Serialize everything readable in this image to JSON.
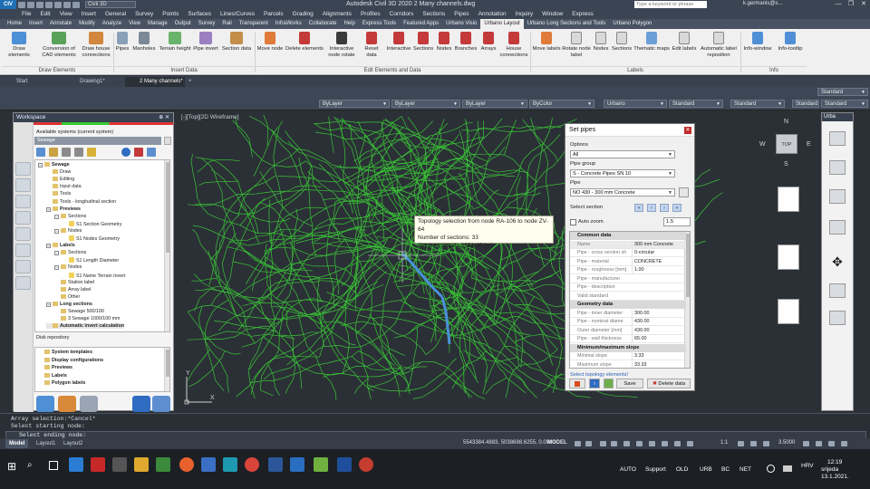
{
  "titlebar": {
    "app_icon_label": "CIV",
    "workspace": "Civil 3D",
    "title": "Autodesk Civil 3D 2020     2 Many channels.dwg",
    "search_placeholder": "Type a keyword or phrase",
    "user": "k.germanis@s...",
    "minimize": "—",
    "restore": "❐",
    "close": "✕"
  },
  "menubar": {
    "items": [
      "File",
      "Edit",
      "View",
      "Insert",
      "General",
      "Survey",
      "Points",
      "Surfaces",
      "Lines/Curves",
      "Parcels",
      "Grading",
      "Alignments",
      "Profiles",
      "Corridors",
      "Sections",
      "Pipes",
      "Annotation",
      "Inquiry",
      "Window",
      "Express"
    ]
  },
  "ribbon_tabs": {
    "items": [
      "Home",
      "Insert",
      "Annotate",
      "Modify",
      "Analyze",
      "View",
      "Manage",
      "Output",
      "Survey",
      "Rail",
      "Transparent",
      "InfraWorks",
      "Collaborate",
      "Help",
      "Express Tools",
      "Featured Apps",
      "Urbano Visio",
      "Urbano Layout",
      "Urbano Long Sections and Tools",
      "Urbano Polygon"
    ],
    "active": "Urbano Layout"
  },
  "ribbon": {
    "draw_elements": {
      "buttons": [
        "Draw elements",
        "Conversion of CAD elements",
        "Draw house connections"
      ],
      "group": "Draw Elements"
    },
    "insert_data": {
      "buttons": [
        "Pipes",
        "Manholes",
        "Terrain height",
        "Pipe invert",
        "Section data"
      ],
      "group": "Insert Data"
    },
    "edit": {
      "buttons": [
        "Move node",
        "Delete elements",
        "Interactive node rotate",
        "Reset data",
        "Interactive",
        "Sections",
        "Nodes",
        "Branches",
        "Arrays",
        "House connections"
      ],
      "group": "Edit Elements and Data"
    },
    "labels": {
      "buttons": [
        "Move labels",
        "Rotate node label",
        "Nodes",
        "Sections",
        "Thematic maps",
        "Edit labels",
        "Automatic label reposition"
      ],
      "group": "Labels"
    },
    "info": {
      "buttons": [
        "Info-window",
        "Info-tooltip"
      ],
      "group": "Info"
    }
  },
  "filetabs": {
    "items": [
      "Start",
      "Drawing1*",
      "2 Many channels*"
    ],
    "add": "+"
  },
  "propbar": {
    "layer": "0",
    "color": "ByLayer",
    "linetype": "ByLayer",
    "lineweight": "ByLayer",
    "plotstyle": "ByColor",
    "style1": "Urbano",
    "style2": "Standard",
    "style3": "Standard",
    "style4": "Standard",
    "style5": "Standard",
    "style6": "Standard"
  },
  "workspace": {
    "title": "Workspace",
    "pin": "⊕ ✕",
    "available_label": "Available systems (current system)",
    "system": "Sewage",
    "tree": [
      {
        "label": "Sewage",
        "bold": true,
        "indent": 0,
        "expand": "−"
      },
      {
        "label": "Draw",
        "indent": 1
      },
      {
        "label": "Editing",
        "indent": 1
      },
      {
        "label": "Input data",
        "indent": 1
      },
      {
        "label": "Tools",
        "indent": 1
      },
      {
        "label": "Tools - longitudinal section",
        "indent": 1
      },
      {
        "label": "Previews",
        "bold": true,
        "indent": 1,
        "expand": "−"
      },
      {
        "label": "Sections",
        "indent": 2,
        "expand": "−"
      },
      {
        "label": "S1 Section Geometry",
        "indent": 3,
        "star": true
      },
      {
        "label": "Nodes",
        "indent": 2,
        "expand": "−"
      },
      {
        "label": "S1 Nodes Geometry",
        "indent": 3,
        "star": true
      },
      {
        "label": "Labels",
        "bold": true,
        "indent": 1,
        "expand": "−"
      },
      {
        "label": "Sections",
        "indent": 2,
        "expand": "−"
      },
      {
        "label": "S1 Length Diameter",
        "indent": 3,
        "star": true
      },
      {
        "label": "Nodes",
        "indent": 2,
        "expand": "−"
      },
      {
        "label": "S1 Name Terrain Invert",
        "indent": 3,
        "star": true
      },
      {
        "label": "Station label",
        "indent": 2
      },
      {
        "label": "Array label",
        "indent": 2
      },
      {
        "label": "Other",
        "indent": 2
      },
      {
        "label": "Long sections",
        "bold": true,
        "indent": 1,
        "expand": "−"
      },
      {
        "label": "Sewage 500/100",
        "indent": 2
      },
      {
        "label": "3 Sewage 1000/100 mm",
        "indent": 2
      },
      {
        "label": "Automatic invert calculation",
        "bold": true,
        "indent": 1,
        "highlight": true
      }
    ],
    "disk_label": "Disk repository",
    "disk_tree": [
      {
        "label": "System templates",
        "bold": true
      },
      {
        "label": "Display configurations",
        "bold": true
      },
      {
        "label": "Previews",
        "bold": true
      },
      {
        "label": "Labels",
        "bold": true
      },
      {
        "label": "Polygon labels",
        "bold": true
      }
    ]
  },
  "viewport": {
    "label": "[-][Top][2D Wireframe]",
    "ucs_y": "Y",
    "ucs_x": "X"
  },
  "tooltip": {
    "line1": "Topology selection from node RA-106 to node ZV-64",
    "line2": "Number of sections: 33",
    "line3": "Sections length: 1558.35 [m]"
  },
  "dialog": {
    "title": "Set pipes",
    "close": "✕",
    "options_label": "Options",
    "options_value": "All",
    "pipe_group_label": "Pipe group",
    "pipe_group_value": "S - Concrete Pipes SN 10",
    "pipe_label": "Pipe",
    "pipe_value": "NO 430 - 300 mm Concrete",
    "select_section_label": "Select section",
    "nav": [
      "«",
      "‹",
      "›",
      "»"
    ],
    "auto_zoom_label": "Auto zoom",
    "zoom_value": "1.5",
    "categories": [
      {
        "name": "Common data",
        "rows": [
          {
            "n": "Name",
            "v": "300 mm Concrete",
            "highlight": true
          },
          {
            "n": "Pipe - cross section sh",
            "v": "0-circular"
          },
          {
            "n": "Pipe - material",
            "v": "CONCRETE"
          },
          {
            "n": "Pipe - roughness [mm]",
            "v": "1.00"
          },
          {
            "n": "Pipe - manufacturer",
            "v": ""
          },
          {
            "n": "Pipe - description",
            "v": ""
          },
          {
            "n": "Valid standard",
            "v": ""
          }
        ]
      },
      {
        "name": "Geometry data",
        "rows": [
          {
            "n": "Pipe - inner diameter",
            "v": "300.00"
          },
          {
            "n": "Pipe - nominal diame",
            "v": "430.00"
          },
          {
            "n": "Outer diameter [mm]",
            "v": "430.00"
          },
          {
            "n": "Pipe - wall thickness",
            "v": "65.00"
          }
        ]
      },
      {
        "name": "Minimum/maximum slope",
        "rows": [
          {
            "n": "Minimal slope",
            "v": "3.33"
          },
          {
            "n": "Maximum slope",
            "v": "33.33"
          }
        ]
      }
    ],
    "topology_link": "Select topology elements!",
    "save": "Save",
    "delete": "Delete data"
  },
  "viewcube": {
    "n": "N",
    "w": "W",
    "top": "TOP",
    "s": "S",
    "e": "E"
  },
  "urbano_panel": {
    "title": "Urba"
  },
  "cmdline": {
    "line1": "Array selection:*Cancel*",
    "line2": "Select starting node:",
    "input": "Select ending node:"
  },
  "statusbar": {
    "tabs": [
      "Model",
      "Layout1",
      "Layout2"
    ],
    "active": "Model",
    "coords": "5543384.4883, 5038698.6255, 0.0000",
    "model": "MODEL",
    "scale": "1:1",
    "zoom": "3.5000"
  },
  "taskbar": {
    "tray": [
      "AUTO",
      "Support",
      "OLD",
      "URB",
      "BC",
      "NET"
    ],
    "lang": "HRV",
    "time": "12:19",
    "day": "srijeda",
    "date": "13.1.2021."
  },
  "colors": {
    "network": "#39c636",
    "selected": "#4a90d9",
    "ribbon_bg": "#f0f0f0",
    "title_bg": "#3b4453"
  }
}
